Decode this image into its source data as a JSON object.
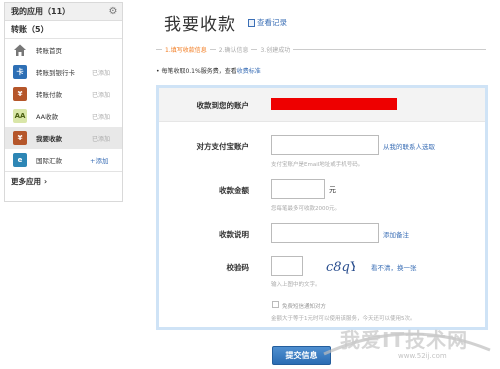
{
  "sidebar": {
    "header": "我的应用（11）",
    "section": "转账（5）",
    "items": [
      {
        "label": "转账首页",
        "status": "",
        "color": "#7a7a7a"
      },
      {
        "label": "转账到银行卡",
        "status": "已添加",
        "color": "#2d6fb5"
      },
      {
        "label": "转账付款",
        "status": "已添加",
        "color": "#b5562a"
      },
      {
        "label": "AA收款",
        "status": "已添加",
        "color": "#9bb53a"
      },
      {
        "label": "我要收款",
        "status": "已添加",
        "color": "#b5562a"
      },
      {
        "label": "国际汇款",
        "status": "+添加",
        "color": "#2d86b5"
      }
    ],
    "more": "更多应用"
  },
  "page": {
    "title": "我要收款",
    "view_records": "查看记录"
  },
  "steps": [
    "1.填写收款信息",
    "2.确认信息",
    "3.创建成功"
  ],
  "notice": {
    "text": "• 每笔收取0.1%服务费，查看",
    "link": "收费标准"
  },
  "form": {
    "account_label": "收款到您的账户",
    "payer_label": "对方支付宝账户",
    "payer_value": "",
    "contacts_link": "从我的联系人选取",
    "payer_hint": "支付宝账户是Email地址或手机号码。",
    "amount_label": "收款金额",
    "amount_value": "",
    "amount_unit": "元",
    "amount_hint": "您每笔最多可收款2000元。",
    "desc_label": "收款说明",
    "desc_value": "",
    "add_note_link": "添加备注",
    "captcha_label": "校验码",
    "captcha_value": "",
    "captcha_text": "c8qY",
    "refresh_link": "看不清，换一张",
    "captcha_hint": "输入上图中的文字。",
    "notify_label": "免费短信通知对方",
    "notify_hint": "金额大于等于1元时可以使用该服务，今天还可以使用5次。"
  },
  "submit": "提交信息",
  "watermark": {
    "text": "我爱IT技术网",
    "url": "www.52ij.com"
  }
}
